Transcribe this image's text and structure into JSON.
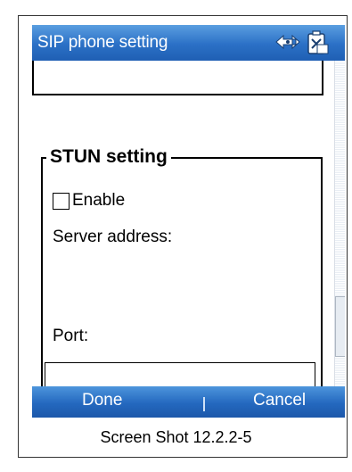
{
  "window": {
    "title": "SIP phone setting"
  },
  "titlebar_icons": [
    "connectivity-icon",
    "battery-status-icon"
  ],
  "stun": {
    "legend": "STUN setting",
    "enable_label": "Enable",
    "enable_checked": false,
    "server_label": "Server address:",
    "port_label": "Port:",
    "port_value": ""
  },
  "softkeys": {
    "left": "Done",
    "right": "Cancel"
  },
  "caption": "Screen Shot 12.2.2-5",
  "colors": {
    "titlebar": "#2b70c6",
    "softbar": "#2468bf",
    "text": "#000000"
  }
}
